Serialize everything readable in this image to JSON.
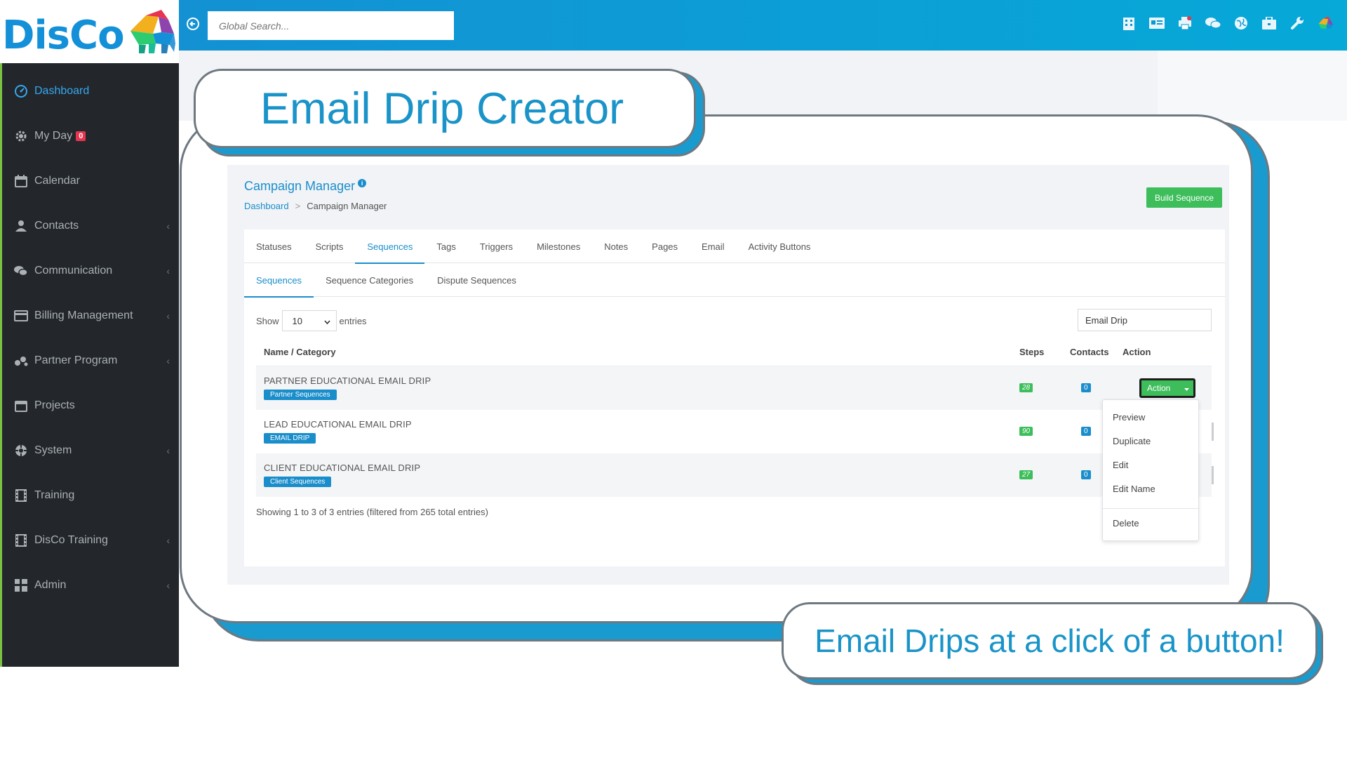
{
  "app": {
    "logo_text": "DisCo"
  },
  "sidebar": {
    "items": [
      {
        "label": "Dashboard",
        "icon": "dashboard-icon",
        "active": true
      },
      {
        "label": "My Day",
        "icon": "gear-icon",
        "badge": "0"
      },
      {
        "label": "Calendar",
        "icon": "calendar-icon"
      },
      {
        "label": "Contacts",
        "icon": "user-icon",
        "chevron": "‹"
      },
      {
        "label": "Communication",
        "icon": "chat-icon",
        "chevron": "‹"
      },
      {
        "label": "Billing Management",
        "icon": "credit-card-icon",
        "chevron": "‹"
      },
      {
        "label": "Partner Program",
        "icon": "partner-icon",
        "chevron": "‹"
      },
      {
        "label": "Projects",
        "icon": "folder-icon"
      },
      {
        "label": "System",
        "icon": "cog-icon",
        "chevron": "‹"
      },
      {
        "label": "Training",
        "icon": "film-icon"
      },
      {
        "label": "DisCo Training",
        "icon": "film-icon",
        "chevron": "‹"
      },
      {
        "label": "Admin",
        "icon": "grid-icon",
        "chevron": "‹"
      }
    ]
  },
  "topbar": {
    "search_placeholder": "Global Search...",
    "icons": [
      "building-icon",
      "id-card-icon",
      "printer-icon",
      "comments-icon",
      "globe-icon",
      "briefcase-icon",
      "wrench-icon",
      "avatar-icon"
    ]
  },
  "callouts": {
    "title": "Email Drip Creator",
    "subtitle": "Email Drips at a click of a button!"
  },
  "page": {
    "title": "Campaign Manager",
    "info_glyph": "i",
    "breadcrumb": {
      "home": "Dashboard",
      "separator": ">",
      "current": "Campaign Manager"
    },
    "build_button": "Build Sequence"
  },
  "tabs": {
    "primary": [
      "Statuses",
      "Scripts",
      "Sequences",
      "Tags",
      "Triggers",
      "Milestones",
      "Notes",
      "Pages",
      "Email",
      "Activity Buttons"
    ],
    "primary_active": 2,
    "secondary": [
      "Sequences",
      "Sequence Categories",
      "Dispute Sequences"
    ],
    "secondary_active": 0
  },
  "table_controls": {
    "show_label": "Show",
    "entries_value": "10",
    "entries_label": "entries",
    "filter_value": "Email Drip"
  },
  "table": {
    "columns": [
      "Name / Category",
      "Steps",
      "Contacts",
      "Action"
    ],
    "rows": [
      {
        "name": "PARTNER EDUCATIONAL EMAIL DRIP",
        "category": "Partner Sequences",
        "steps": "28",
        "contacts": "0"
      },
      {
        "name": "LEAD EDUCATIONAL EMAIL DRIP",
        "category": "EMAIL DRIP",
        "steps": "90",
        "contacts": "0"
      },
      {
        "name": "CLIENT EDUCATIONAL EMAIL DRIP",
        "category": "Client Sequences",
        "steps": "27",
        "contacts": "0"
      }
    ],
    "action_label": "Action",
    "summary": "Showing 1 to 3 of 3 entries (filtered from 265 total entries)"
  },
  "dropdown": {
    "items": [
      "Preview",
      "Duplicate",
      "Edit",
      "Edit Name",
      "Delete"
    ]
  },
  "colors": {
    "accent": "#1a8ecb",
    "success": "#3dbe5b",
    "sidebar_bg": "#23272b",
    "topbar_start": "#1391d3",
    "topbar_end": "#06a9d8",
    "callout_text": "#1a94c8"
  }
}
